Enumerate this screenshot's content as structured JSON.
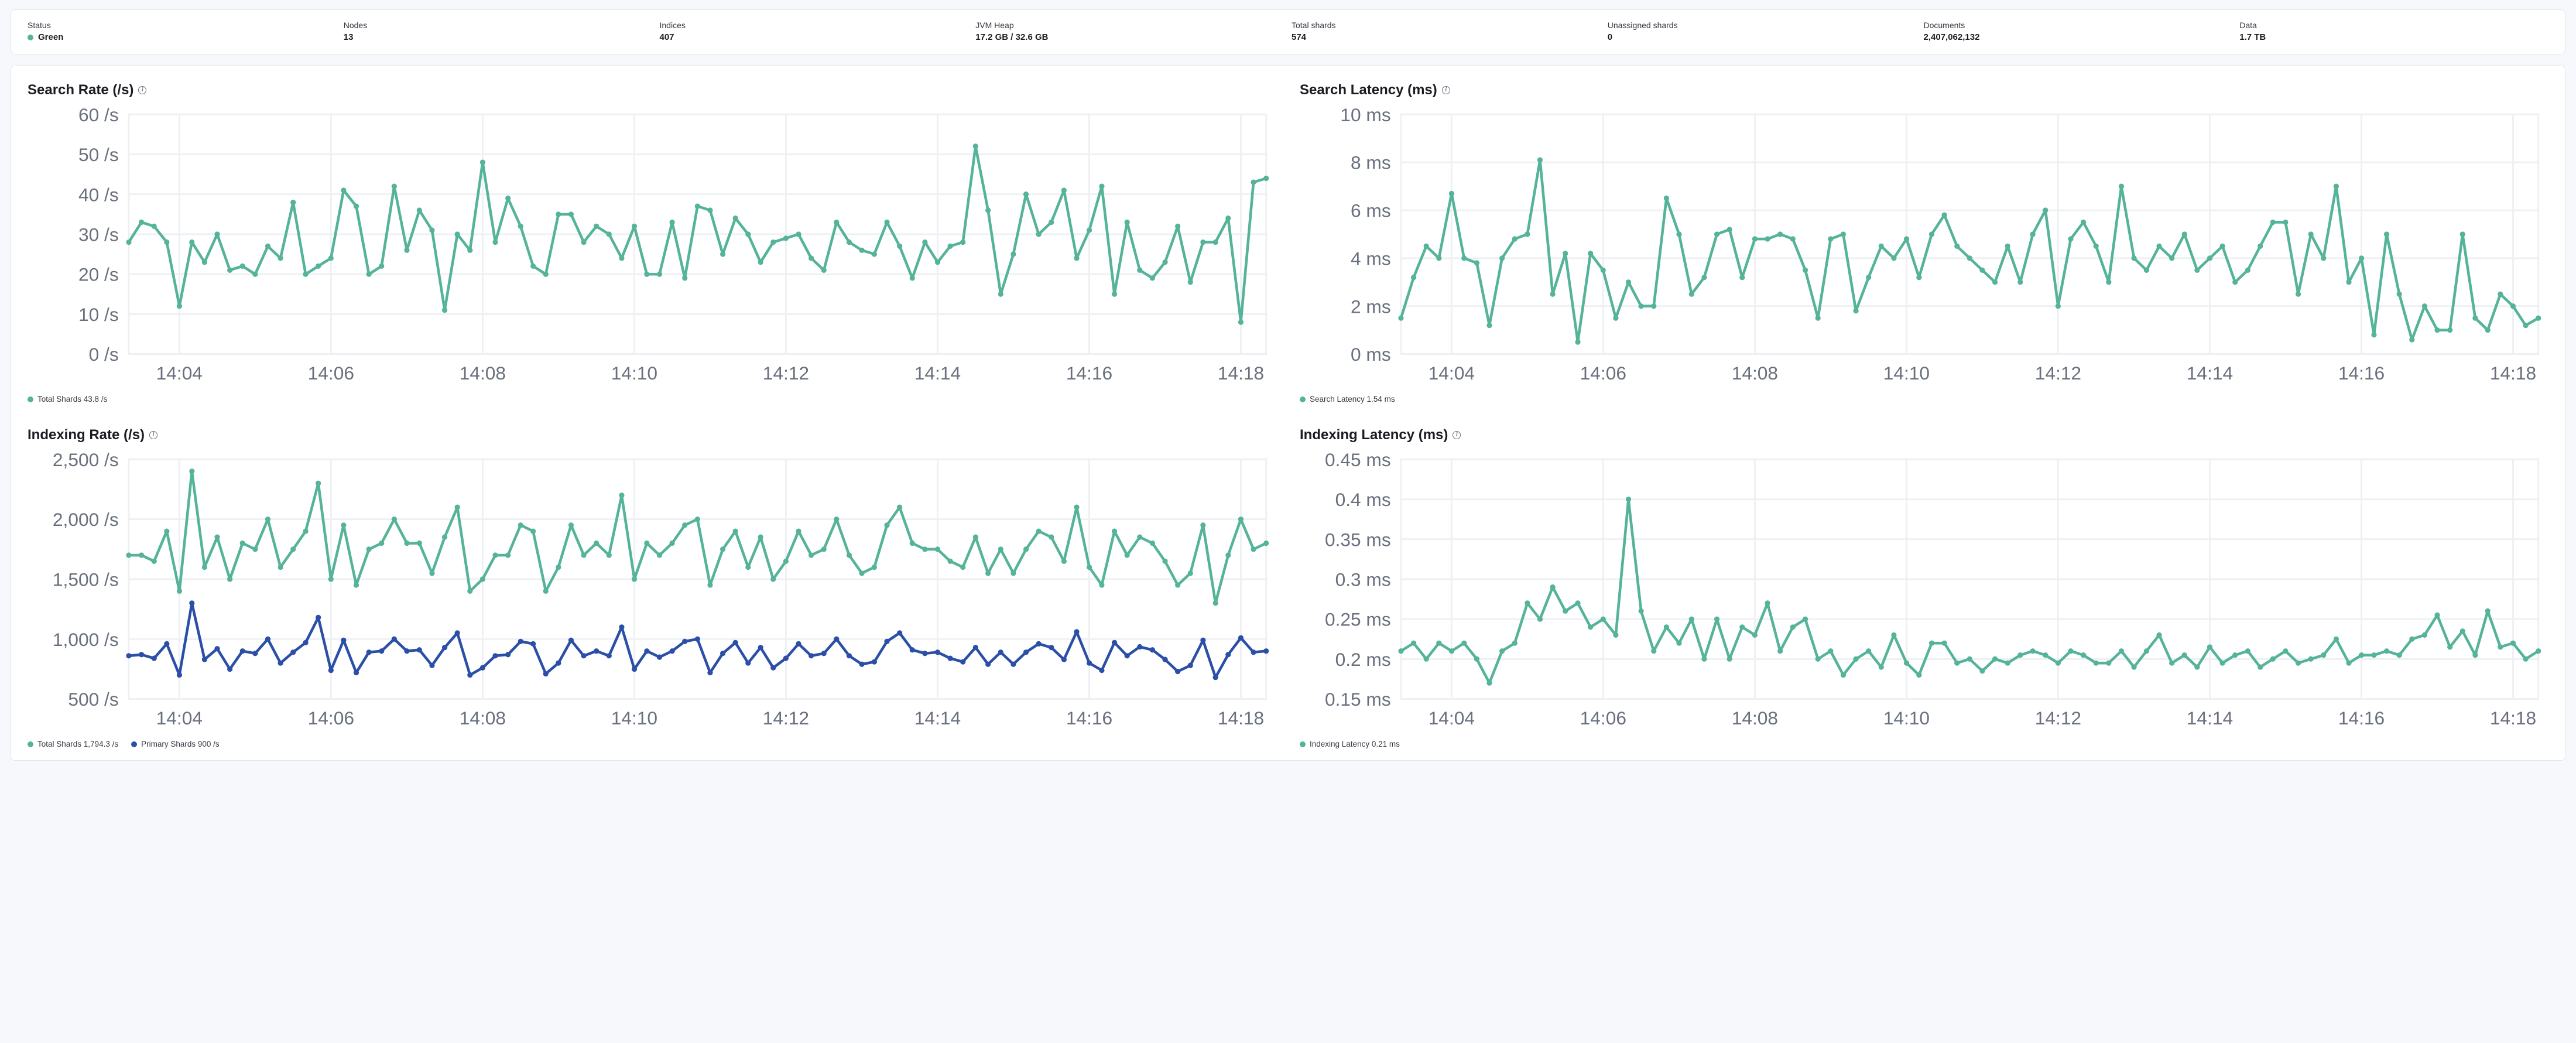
{
  "colors": {
    "teal": "#54B399",
    "blue": "#2B4FA7",
    "grid": "#EEF0F4",
    "border": "#E3E6EF",
    "axis": "#69707D",
    "status_green": "#54B399"
  },
  "stats": [
    {
      "label": "Status",
      "value": "Green",
      "status_color": "status_green"
    },
    {
      "label": "Nodes",
      "value": "13"
    },
    {
      "label": "Indices",
      "value": "407"
    },
    {
      "label": "JVM Heap",
      "value": "17.2 GB / 32.6 GB"
    },
    {
      "label": "Total shards",
      "value": "574"
    },
    {
      "label": "Unassigned shards",
      "value": "0"
    },
    {
      "label": "Documents",
      "value": "2,407,062,132"
    },
    {
      "label": "Data",
      "value": "1.7 TB"
    }
  ],
  "x_tick_labels": [
    "14:04",
    "14:06",
    "14:08",
    "14:10",
    "14:12",
    "14:14",
    "14:16",
    "14:18"
  ],
  "x_tick_positions": [
    4,
    16,
    28,
    40,
    52,
    64,
    76,
    88
  ],
  "chart_data": [
    {
      "id": "search-rate",
      "title": "Search Rate (/s)",
      "type": "line",
      "x": [
        0,
        1,
        2,
        3,
        4,
        5,
        6,
        7,
        8,
        9,
        10,
        11,
        12,
        13,
        14,
        15,
        16,
        17,
        18,
        19,
        20,
        21,
        22,
        23,
        24,
        25,
        26,
        27,
        28,
        29,
        30,
        31,
        32,
        33,
        34,
        35,
        36,
        37,
        38,
        39,
        40,
        41,
        42,
        43,
        44,
        45,
        46,
        47,
        48,
        49,
        50,
        51,
        52,
        53,
        54,
        55,
        56,
        57,
        58,
        59,
        60,
        61,
        62,
        63,
        64,
        65,
        66,
        67,
        68,
        69,
        70,
        71,
        72,
        73,
        74,
        75,
        76,
        77,
        78,
        79,
        80,
        81,
        82,
        83,
        84,
        85,
        86,
        87,
        88,
        89,
        90
      ],
      "xlim": [
        0,
        90
      ],
      "ylim": [
        0,
        60
      ],
      "y_ticks": [
        0,
        10,
        20,
        30,
        40,
        50,
        60
      ],
      "y_tick_labels": [
        "0 /s",
        "10 /s",
        "20 /s",
        "30 /s",
        "40 /s",
        "50 /s",
        "60 /s"
      ],
      "series": [
        {
          "name": "Total Shards",
          "color": "teal",
          "legend_value": "43.8 /s",
          "values": [
            28,
            33,
            32,
            28,
            12,
            28,
            23,
            30,
            21,
            22,
            20,
            27,
            24,
            38,
            20,
            22,
            24,
            41,
            37,
            20,
            22,
            42,
            26,
            36,
            31,
            11,
            30,
            26,
            48,
            28,
            39,
            32,
            22,
            20,
            35,
            35,
            28,
            32,
            30,
            24,
            32,
            20,
            20,
            33,
            19,
            37,
            36,
            25,
            34,
            30,
            23,
            28,
            29,
            30,
            24,
            21,
            33,
            28,
            26,
            25,
            33,
            27,
            19,
            28,
            23,
            27,
            28,
            52,
            36,
            15,
            25,
            40,
            30,
            33,
            41,
            24,
            31,
            42,
            15,
            33,
            21,
            19,
            23,
            32,
            18,
            28,
            28,
            34,
            8,
            43,
            44
          ]
        }
      ]
    },
    {
      "id": "search-latency",
      "title": "Search Latency (ms)",
      "type": "line",
      "x": [
        0,
        1,
        2,
        3,
        4,
        5,
        6,
        7,
        8,
        9,
        10,
        11,
        12,
        13,
        14,
        15,
        16,
        17,
        18,
        19,
        20,
        21,
        22,
        23,
        24,
        25,
        26,
        27,
        28,
        29,
        30,
        31,
        32,
        33,
        34,
        35,
        36,
        37,
        38,
        39,
        40,
        41,
        42,
        43,
        44,
        45,
        46,
        47,
        48,
        49,
        50,
        51,
        52,
        53,
        54,
        55,
        56,
        57,
        58,
        59,
        60,
        61,
        62,
        63,
        64,
        65,
        66,
        67,
        68,
        69,
        70,
        71,
        72,
        73,
        74,
        75,
        76,
        77,
        78,
        79,
        80,
        81,
        82,
        83,
        84,
        85,
        86,
        87,
        88,
        89,
        90
      ],
      "xlim": [
        0,
        90
      ],
      "ylim": [
        0,
        10
      ],
      "y_ticks": [
        0,
        2,
        4,
        6,
        8,
        10
      ],
      "y_tick_labels": [
        "0 ms",
        "2 ms",
        "4 ms",
        "6 ms",
        "8 ms",
        "10 ms"
      ],
      "series": [
        {
          "name": "Search Latency",
          "color": "teal",
          "legend_value": "1.54 ms",
          "values": [
            1.5,
            3.2,
            4.5,
            4.0,
            6.7,
            4.0,
            3.8,
            1.2,
            4.0,
            4.8,
            5.0,
            8.1,
            2.5,
            4.2,
            0.5,
            4.2,
            3.5,
            1.5,
            3.0,
            2.0,
            2.0,
            6.5,
            5.0,
            2.5,
            3.2,
            5.0,
            5.2,
            3.2,
            4.8,
            4.8,
            5.0,
            4.8,
            3.5,
            1.5,
            4.8,
            5.0,
            1.8,
            3.2,
            4.5,
            4.0,
            4.8,
            3.2,
            5.0,
            5.8,
            4.5,
            4.0,
            3.5,
            3.0,
            4.5,
            3.0,
            5.0,
            6.0,
            2.0,
            4.8,
            5.5,
            4.5,
            3.0,
            7.0,
            4.0,
            3.5,
            4.5,
            4.0,
            5.0,
            3.5,
            4.0,
            4.5,
            3.0,
            3.5,
            4.5,
            5.5,
            5.5,
            2.5,
            5.0,
            4.0,
            7.0,
            3.0,
            4.0,
            0.8,
            5.0,
            2.5,
            0.6,
            2.0,
            1.0,
            1.0,
            5.0,
            1.5,
            1.0,
            2.5,
            2.0,
            1.2,
            1.5
          ]
        }
      ]
    },
    {
      "id": "indexing-rate",
      "title": "Indexing Rate (/s)",
      "type": "line",
      "x": [
        0,
        1,
        2,
        3,
        4,
        5,
        6,
        7,
        8,
        9,
        10,
        11,
        12,
        13,
        14,
        15,
        16,
        17,
        18,
        19,
        20,
        21,
        22,
        23,
        24,
        25,
        26,
        27,
        28,
        29,
        30,
        31,
        32,
        33,
        34,
        35,
        36,
        37,
        38,
        39,
        40,
        41,
        42,
        43,
        44,
        45,
        46,
        47,
        48,
        49,
        50,
        51,
        52,
        53,
        54,
        55,
        56,
        57,
        58,
        59,
        60,
        61,
        62,
        63,
        64,
        65,
        66,
        67,
        68,
        69,
        70,
        71,
        72,
        73,
        74,
        75,
        76,
        77,
        78,
        79,
        80,
        81,
        82,
        83,
        84,
        85,
        86,
        87,
        88,
        89,
        90
      ],
      "xlim": [
        0,
        90
      ],
      "ylim": [
        500,
        2500
      ],
      "y_ticks": [
        500,
        1000,
        1500,
        2000,
        2500
      ],
      "y_tick_labels": [
        "500 /s",
        "1,000 /s",
        "1,500 /s",
        "2,000 /s",
        "2,500 /s"
      ],
      "series": [
        {
          "name": "Total Shards",
          "color": "teal",
          "legend_value": "1,794.3 /s",
          "values": [
            1700,
            1700,
            1650,
            1900,
            1400,
            2400,
            1600,
            1850,
            1500,
            1800,
            1750,
            2000,
            1600,
            1750,
            1900,
            2300,
            1500,
            1950,
            1450,
            1750,
            1800,
            2000,
            1800,
            1800,
            1550,
            1850,
            2100,
            1400,
            1500,
            1700,
            1700,
            1950,
            1900,
            1400,
            1600,
            1950,
            1700,
            1800,
            1700,
            2200,
            1500,
            1800,
            1700,
            1800,
            1950,
            2000,
            1450,
            1750,
            1900,
            1600,
            1850,
            1500,
            1650,
            1900,
            1700,
            1750,
            2000,
            1700,
            1550,
            1600,
            1950,
            2100,
            1800,
            1750,
            1750,
            1650,
            1600,
            1850,
            1550,
            1750,
            1550,
            1750,
            1900,
            1850,
            1650,
            2100,
            1600,
            1450,
            1900,
            1700,
            1850,
            1800,
            1650,
            1450,
            1550,
            1950,
            1300,
            1700,
            2000,
            1750,
            1800
          ]
        },
        {
          "name": "Primary Shards",
          "color": "blue",
          "legend_value": "900 /s",
          "values": [
            860,
            870,
            840,
            960,
            700,
            1300,
            830,
            920,
            750,
            900,
            880,
            1000,
            800,
            890,
            970,
            1180,
            740,
            990,
            720,
            890,
            900,
            1000,
            900,
            910,
            780,
            930,
            1050,
            700,
            760,
            860,
            870,
            980,
            960,
            710,
            800,
            990,
            860,
            900,
            860,
            1100,
            750,
            900,
            850,
            900,
            980,
            1000,
            720,
            880,
            970,
            800,
            930,
            760,
            840,
            960,
            860,
            880,
            1000,
            860,
            790,
            810,
            980,
            1050,
            910,
            880,
            890,
            840,
            810,
            930,
            790,
            890,
            790,
            890,
            960,
            930,
            830,
            1060,
            800,
            740,
            970,
            860,
            935,
            910,
            830,
            730,
            780,
            990,
            680,
            870,
            1010,
            890,
            900
          ]
        }
      ]
    },
    {
      "id": "indexing-latency",
      "title": "Indexing Latency (ms)",
      "type": "line",
      "x": [
        0,
        1,
        2,
        3,
        4,
        5,
        6,
        7,
        8,
        9,
        10,
        11,
        12,
        13,
        14,
        15,
        16,
        17,
        18,
        19,
        20,
        21,
        22,
        23,
        24,
        25,
        26,
        27,
        28,
        29,
        30,
        31,
        32,
        33,
        34,
        35,
        36,
        37,
        38,
        39,
        40,
        41,
        42,
        43,
        44,
        45,
        46,
        47,
        48,
        49,
        50,
        51,
        52,
        53,
        54,
        55,
        56,
        57,
        58,
        59,
        60,
        61,
        62,
        63,
        64,
        65,
        66,
        67,
        68,
        69,
        70,
        71,
        72,
        73,
        74,
        75,
        76,
        77,
        78,
        79,
        80,
        81,
        82,
        83,
        84,
        85,
        86,
        87,
        88,
        89,
        90
      ],
      "xlim": [
        0,
        90
      ],
      "ylim": [
        0.15,
        0.45
      ],
      "y_ticks": [
        0.15,
        0.2,
        0.25,
        0.3,
        0.35,
        0.4,
        0.45
      ],
      "y_tick_labels": [
        "0.15 ms",
        "0.2 ms",
        "0.25 ms",
        "0.3 ms",
        "0.35 ms",
        "0.4 ms",
        "0.45 ms"
      ],
      "series": [
        {
          "name": "Indexing Latency",
          "color": "teal",
          "legend_value": "0.21 ms",
          "values": [
            0.21,
            0.22,
            0.2,
            0.22,
            0.21,
            0.22,
            0.2,
            0.17,
            0.21,
            0.22,
            0.27,
            0.25,
            0.29,
            0.26,
            0.27,
            0.24,
            0.25,
            0.23,
            0.4,
            0.26,
            0.21,
            0.24,
            0.22,
            0.25,
            0.2,
            0.25,
            0.2,
            0.24,
            0.23,
            0.27,
            0.21,
            0.24,
            0.25,
            0.2,
            0.21,
            0.18,
            0.2,
            0.21,
            0.19,
            0.23,
            0.195,
            0.18,
            0.22,
            0.22,
            0.195,
            0.2,
            0.185,
            0.2,
            0.195,
            0.205,
            0.21,
            0.205,
            0.195,
            0.21,
            0.205,
            0.195,
            0.195,
            0.21,
            0.19,
            0.21,
            0.23,
            0.195,
            0.205,
            0.19,
            0.215,
            0.195,
            0.205,
            0.21,
            0.19,
            0.2,
            0.21,
            0.195,
            0.2,
            0.205,
            0.225,
            0.195,
            0.205,
            0.205,
            0.21,
            0.205,
            0.225,
            0.23,
            0.255,
            0.215,
            0.235,
            0.205,
            0.26,
            0.215,
            0.22,
            0.2,
            0.21
          ]
        }
      ]
    }
  ]
}
